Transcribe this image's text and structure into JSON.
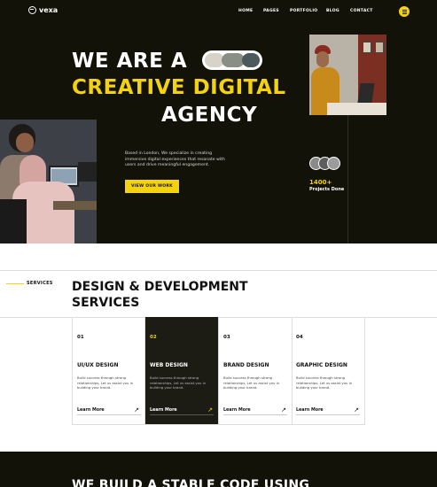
{
  "brand": {
    "name": "vexa",
    "accent": "#f5d20e",
    "dark": "#121208"
  },
  "nav": {
    "links": [
      "HOME",
      "PAGES",
      "PORTFOLIO",
      "BLOG",
      "CONTACT"
    ],
    "menu_icon": "hamburger-icon"
  },
  "hero": {
    "line1": "WE ARE A",
    "line2": "CREATIVE DIGITAL",
    "line3": "AGENCY",
    "description": "Based in London, We specialize in creating immersive digital experiences that resonate with users and drive meaningful engagement.",
    "cta_label": "VIEW OUR WORK",
    "stat_value": "1400+",
    "stat_label": "Projects Done"
  },
  "services": {
    "tag": "SERVICES",
    "title_line1": "DESIGN & DEVELOPMENT",
    "title_line2": "SERVICES",
    "cards": [
      {
        "num": "01",
        "title": "UI/UX DESIGN",
        "text": "Build success through strong relationships, Let us assist you in building your brand.",
        "link": "Learn More"
      },
      {
        "num": "02",
        "title": "WEB DESIGN",
        "text": "Build success through strong relationships, Let us assist you in building your brand.",
        "link": "Learn More"
      },
      {
        "num": "03",
        "title": "BRAND DESIGN",
        "text": "Build success through strong relationships, Let us assist you in building your brand.",
        "link": "Learn More"
      },
      {
        "num": "04",
        "title": "GRAPHIC DESIGN",
        "text": "Build success through strong relationships, Let us assist you in building your brand.",
        "link": "Learn More"
      }
    ]
  },
  "next_section": {
    "title": "WE BUILD A STABLE CODE USING"
  }
}
